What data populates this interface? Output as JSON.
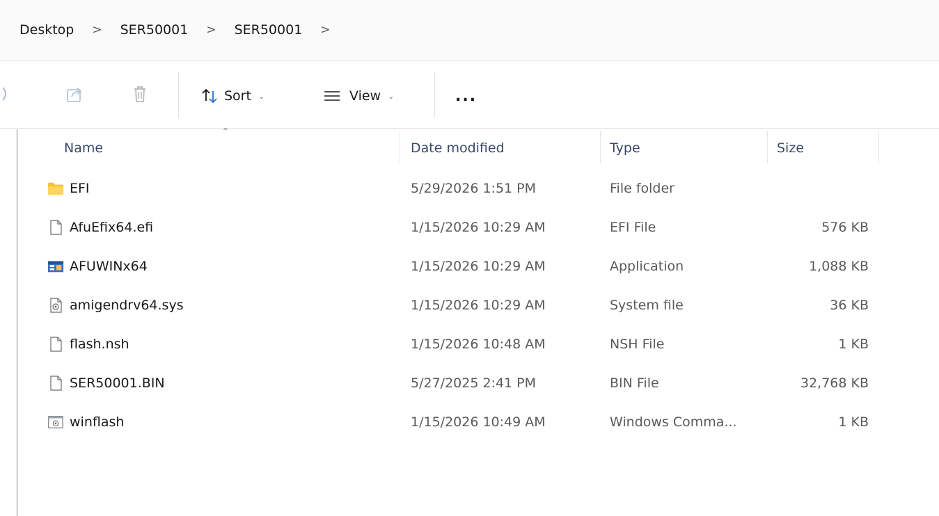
{
  "breadcrumb": {
    "items": [
      "Desktop",
      "SER50001",
      "SER50001"
    ],
    "separator": ">"
  },
  "toolbar": {
    "sort_label": "Sort",
    "view_label": "View",
    "more_label": "..."
  },
  "columns": {
    "name": "Name",
    "date": "Date modified",
    "type": "Type",
    "size": "Size"
  },
  "files": [
    {
      "name": "EFI",
      "date": "5/29/2026 1:51 PM",
      "type": "File folder",
      "size": "",
      "icon": "folder-icon"
    },
    {
      "name": "AfuEfix64.efi",
      "date": "1/15/2026 10:29 AM",
      "type": "EFI File",
      "size": "576 KB",
      "icon": "file-icon"
    },
    {
      "name": "AFUWINx64",
      "date": "1/15/2026 10:29 AM",
      "type": "Application",
      "size": "1,088 KB",
      "icon": "application-icon"
    },
    {
      "name": "amigendrv64.sys",
      "date": "1/15/2026 10:29 AM",
      "type": "System file",
      "size": "36 KB",
      "icon": "system-file-icon"
    },
    {
      "name": "flash.nsh",
      "date": "1/15/2026 10:48 AM",
      "type": "NSH File",
      "size": "1 KB",
      "icon": "file-icon"
    },
    {
      "name": "SER50001.BIN",
      "date": "5/27/2025 2:41 PM",
      "type": "BIN File",
      "size": "32,768 KB",
      "icon": "file-icon"
    },
    {
      "name": "winflash",
      "date": "1/15/2026 10:49 AM",
      "type": "Windows Comma...",
      "size": "1 KB",
      "icon": "batch-file-icon"
    }
  ],
  "colors": {
    "folder": "#f4c430",
    "header_text": "#3a4a6a",
    "secondary_text": "#5a5a5a"
  }
}
